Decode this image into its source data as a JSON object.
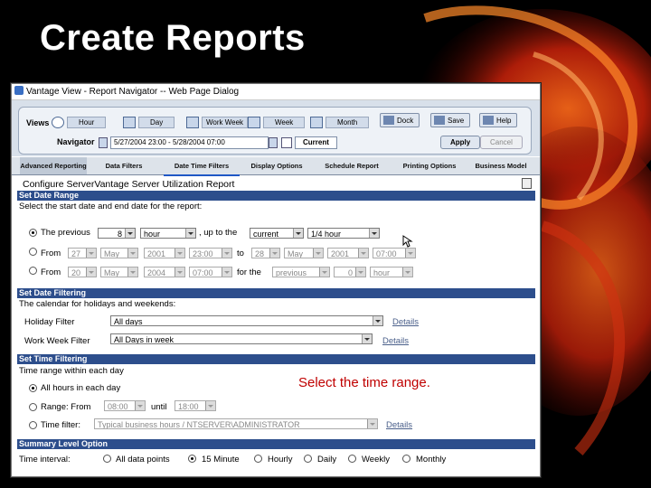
{
  "slide": {
    "title": "Create Reports",
    "callout": "Select the time range."
  },
  "window": {
    "title": "Vantage View - Report Navigator -- Web Page Dialog"
  },
  "toolbar": {
    "views_label": "Views",
    "view_buttons": [
      "Hour",
      "Day",
      "Work Week",
      "Week",
      "Month"
    ],
    "navigator_label": "Navigator",
    "navigator_value": "5/27/2004 23:00 - 5/28/2004 07:00",
    "current_label": "Current",
    "dock_label": "Dock",
    "save_label": "Save",
    "help_label": "Help",
    "apply_label": "Apply",
    "cancel_label": "Cancel"
  },
  "tabs": [
    "Advanced Reporting",
    "Data Filters",
    "Date Time Filters",
    "Display Options",
    "Schedule Report",
    "Printing Options",
    "Business Model"
  ],
  "heading": "Configure ServerVantage Server Utilization Report",
  "date_range": {
    "section": "Set Date Range",
    "instruction": "Select the start date and end date for the report:",
    "row1": {
      "prefix": "The previous",
      "count": "8",
      "unit": "hour",
      "mid": ", up to the",
      "anchor": "current",
      "granularity": "1/4 hour"
    },
    "row2": {
      "prefix": "From",
      "day": "27",
      "month": "May",
      "year": "2001",
      "time": "23:00",
      "to": "to",
      "day2": "28",
      "month2": "May",
      "year2": "2001",
      "time2": "07:00"
    },
    "row3": {
      "prefix": "From",
      "day": "20",
      "month": "May",
      "year": "2004",
      "time": "07:00",
      "mid": "for the",
      "anchor": "previous",
      "count": "0",
      "unit": "hour"
    }
  },
  "date_filtering": {
    "section": "Set Date Filtering",
    "instruction": "The calendar for holidays and weekends:",
    "holiday_label": "Holiday Filter",
    "holiday_value": "All days",
    "workweek_label": "Work Week Filter",
    "workweek_value": "All Days in week",
    "details": "Details"
  },
  "time_filtering": {
    "section": "Set Time Filtering",
    "instruction": "Time range within each day",
    "opt1": "All hours in each day",
    "opt2": "Range: From",
    "from_value": "08:00",
    "until_label": "until",
    "until_value": "18:00",
    "opt3": "Time filter:",
    "filter_value": "Typical business hours / NTSERVER\\ADMINISTRATOR",
    "details": "Details"
  },
  "summary": {
    "section": "Summary Level Option",
    "label": "Time interval:",
    "options": [
      "All data points",
      "15 Minute",
      "Hourly",
      "Daily",
      "Weekly",
      "Monthly"
    ]
  }
}
